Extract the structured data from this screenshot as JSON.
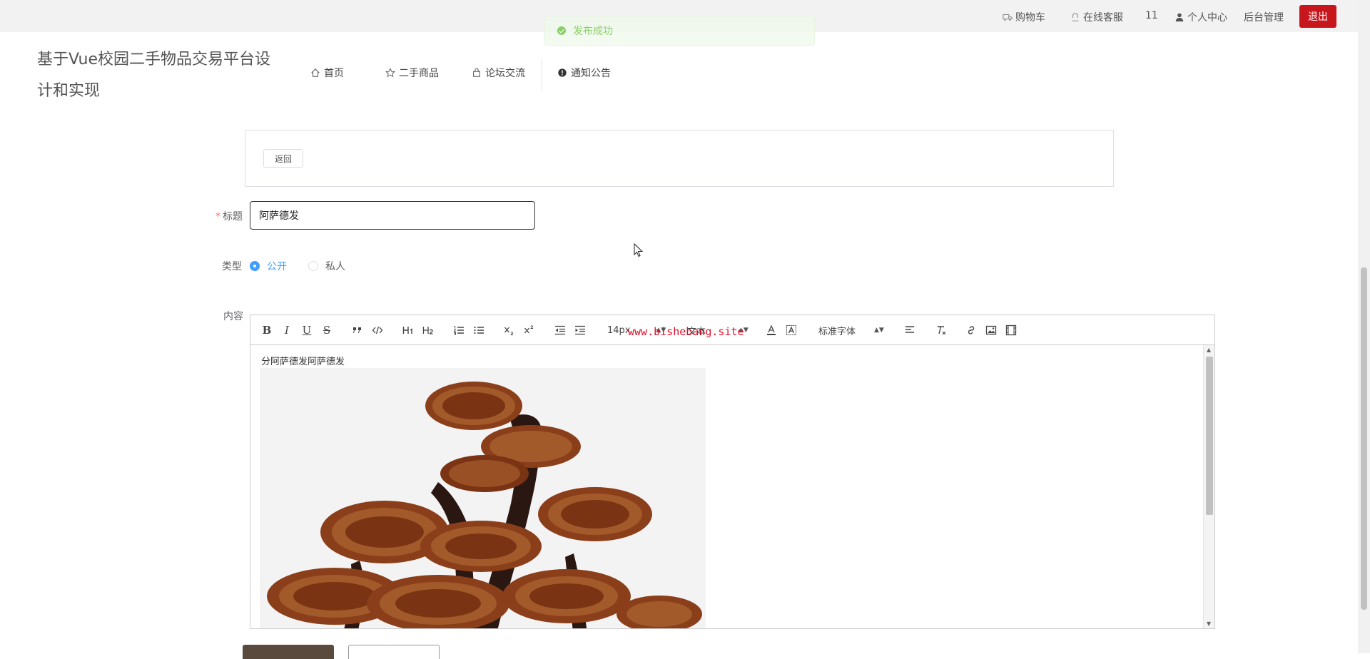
{
  "topbar": {
    "cart": "购物车",
    "service": "在线客服",
    "user_id": "11",
    "profile": "个人中心",
    "admin": "后台管理",
    "logout": "退出"
  },
  "toast": {
    "message": "发布成功",
    "status_color": "#67c23a"
  },
  "site": {
    "title": "基于Vue校园二手物品交易平台设计和实现"
  },
  "nav": [
    {
      "label": "首页",
      "icon": "home-icon"
    },
    {
      "label": "二手商品",
      "icon": "star-icon"
    },
    {
      "label": "论坛交流",
      "icon": "bag-icon"
    },
    {
      "label": "通知公告",
      "icon": "info-icon"
    }
  ],
  "form": {
    "back_label": "返回",
    "title_label": "标题",
    "title_required_mark": "*",
    "title_value": "阿萨德发",
    "type_label": "类型",
    "type_options": [
      "公开",
      "私人"
    ],
    "type_selected": "公开",
    "content_label": "内容"
  },
  "editor": {
    "size_value": "14px",
    "header_value": "文本",
    "font_value": "标准字体",
    "content_text": "分阿萨德发阿萨德发",
    "watermark": "www.bishebang.site"
  },
  "colors": {
    "accent": "#409eff",
    "danger": "#c8161d",
    "submit": "#5a4a3e"
  }
}
